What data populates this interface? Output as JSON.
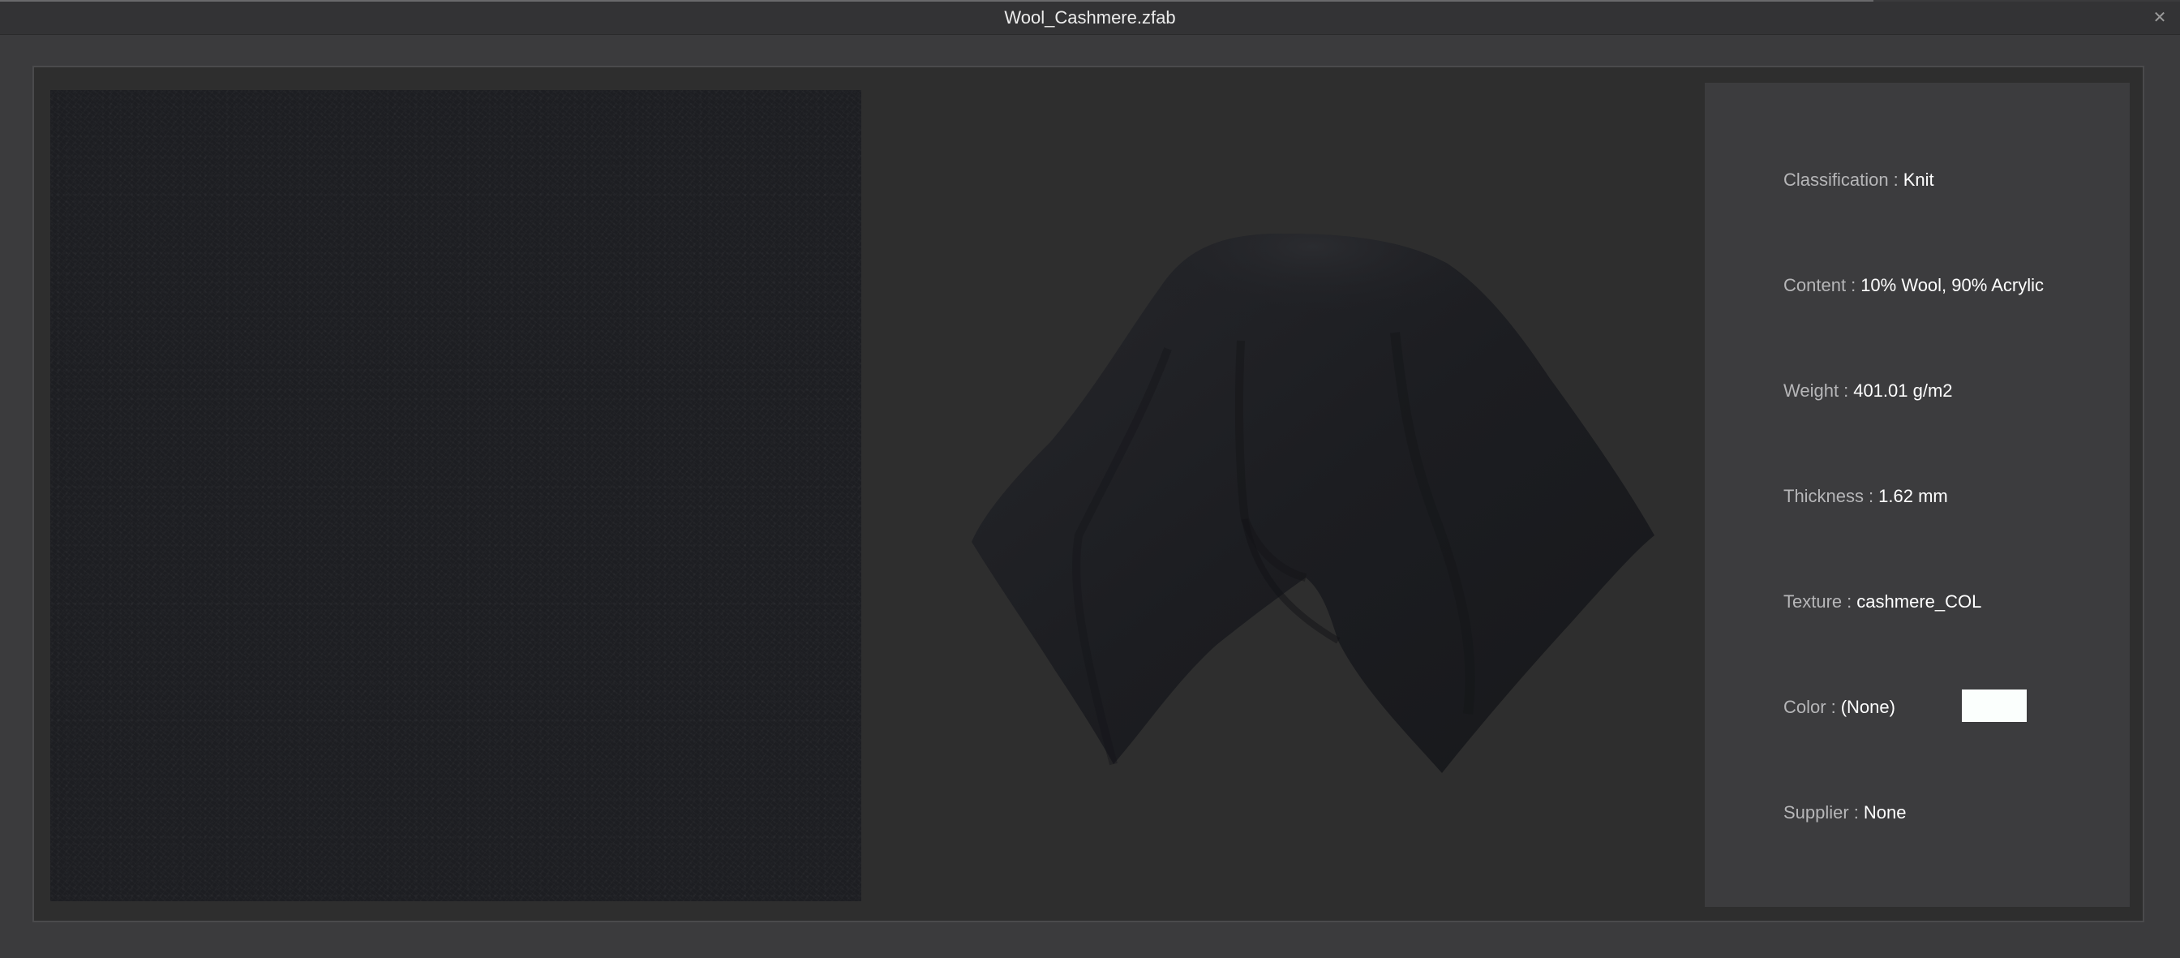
{
  "window": {
    "title": "Wool_Cashmere.zfab",
    "close_glyph": "✕"
  },
  "info": {
    "separator": ":",
    "classification": {
      "label": "Classification",
      "value": "Knit"
    },
    "content": {
      "label": "Content",
      "value": "10% Wool, 90% Acrylic"
    },
    "weight": {
      "label": "Weight",
      "value": "401.01 g/m2"
    },
    "thickness": {
      "label": "Thickness",
      "value": "1.62 mm"
    },
    "texture": {
      "label": "Texture",
      "value": "cashmere_COL"
    },
    "color": {
      "label": "Color",
      "value": "(None)",
      "swatch": "#fbfffd"
    },
    "supplier": {
      "label": "Supplier",
      "value": "None"
    }
  },
  "colors": {
    "window_bg": "#3b3b3d",
    "frame_bg": "#2e2e2e",
    "panel_bg": "#3c3c3e",
    "fabric": "#1d1e22"
  }
}
